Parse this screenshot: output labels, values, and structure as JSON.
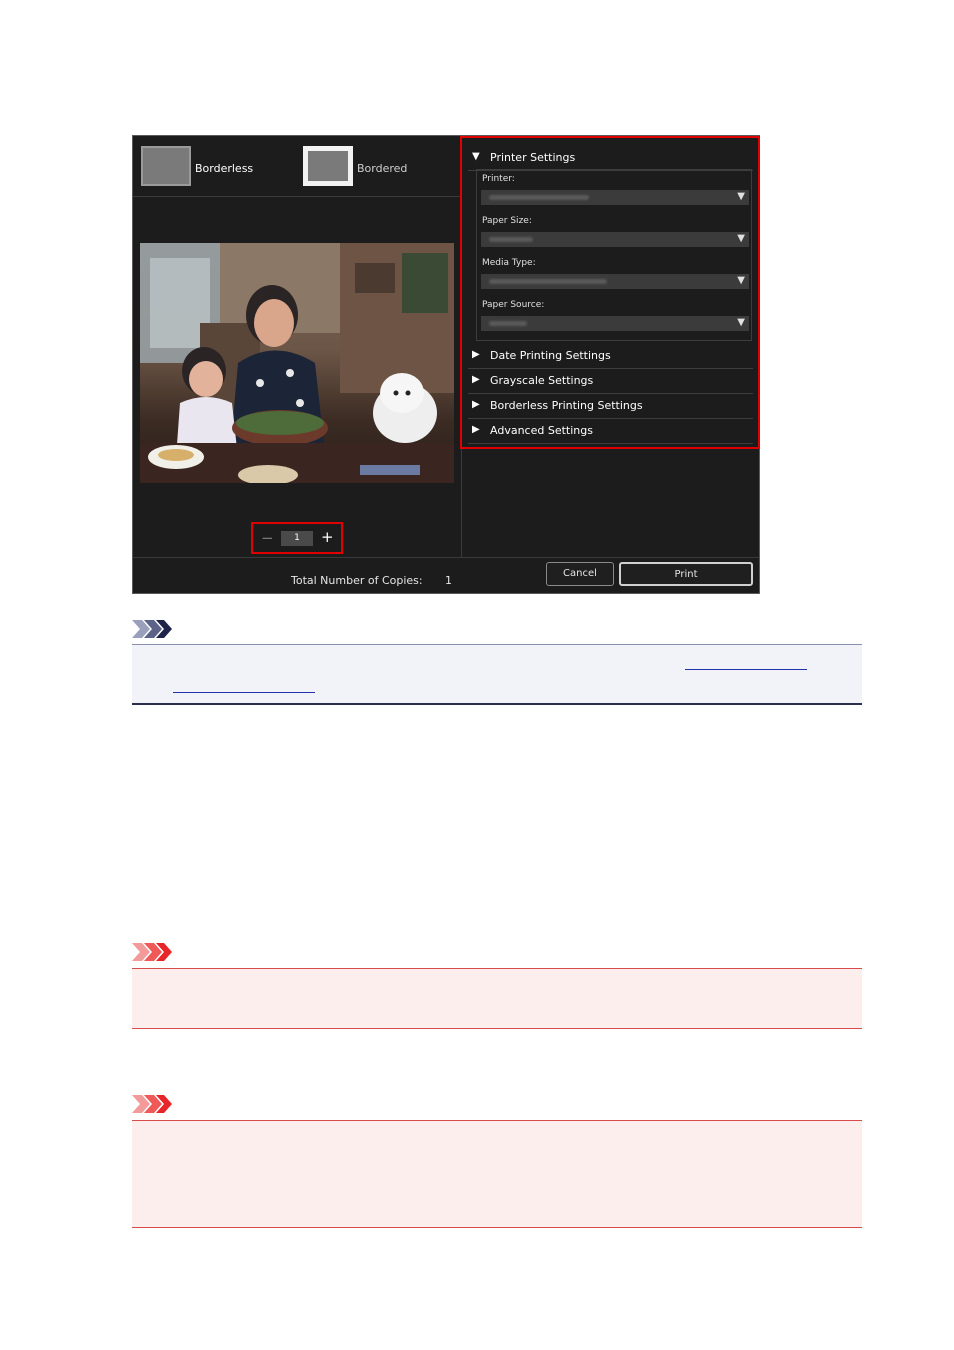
{
  "dialog": {
    "layouts": {
      "borderless_label": "Borderless",
      "bordered_label": "Bordered"
    },
    "copies": {
      "minus_symbol": "−",
      "plus_symbol": "+",
      "value": "1"
    },
    "printer_settings": {
      "header": "Printer Settings",
      "fields": [
        {
          "label": "Printer:"
        },
        {
          "label": "Paper Size:"
        },
        {
          "label": "Media Type:"
        },
        {
          "label": "Paper Source:"
        }
      ]
    },
    "sections": [
      "Date Printing Settings",
      "Grayscale Settings",
      "Borderless Printing Settings",
      "Advanced Settings"
    ],
    "footer": {
      "total_label": "Total Number of Copies:",
      "total_value": "1",
      "cancel_label": "Cancel",
      "print_label": "Print"
    }
  },
  "colors": {
    "highlight": "#e00000",
    "note_accent": "#2a2f4e",
    "important_accent": "#e8262a"
  },
  "icons": {
    "expanded": "triangle-down",
    "collapsed": "triangle-right",
    "dropdown": "dropdown-arrow",
    "note": "note-chevron-icon",
    "important": "important-chevron-icon"
  }
}
